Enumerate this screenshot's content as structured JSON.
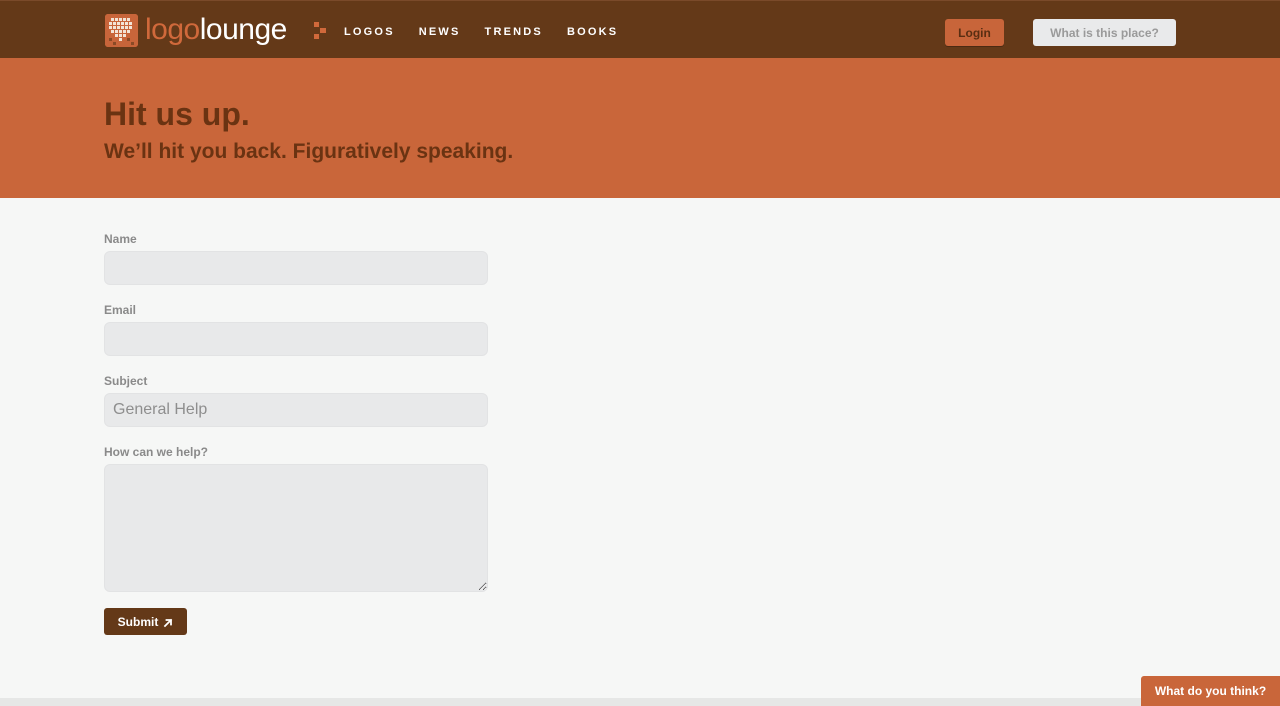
{
  "header": {
    "logo_text_part1": "logo",
    "logo_text_part2": "lounge",
    "menu_icon": "menu-dots-icon",
    "nav": [
      {
        "label": "LOGOS"
      },
      {
        "label": "NEWS"
      },
      {
        "label": "TRENDS"
      },
      {
        "label": "BOOKS"
      }
    ],
    "login_label": "Login",
    "about_label": "What is this place?"
  },
  "hero": {
    "title": "Hit us up.",
    "subtitle": "We’ll hit you back. Figuratively speaking."
  },
  "form": {
    "name_label": "Name",
    "name_value": "",
    "email_label": "Email",
    "email_value": "",
    "subject_label": "Subject",
    "subject_placeholder": "General Help",
    "message_label": "How can we help?",
    "message_value": "",
    "submit_label": "Submit",
    "submit_icon": "arrow-up-right-icon"
  },
  "feedback": {
    "label": "What do you think?"
  },
  "colors": {
    "nav_bg": "#643918",
    "accent": "#c9663a",
    "hero_text": "#6a3312",
    "page_bg": "#f6f7f6",
    "input_bg": "#e8e9ea"
  }
}
